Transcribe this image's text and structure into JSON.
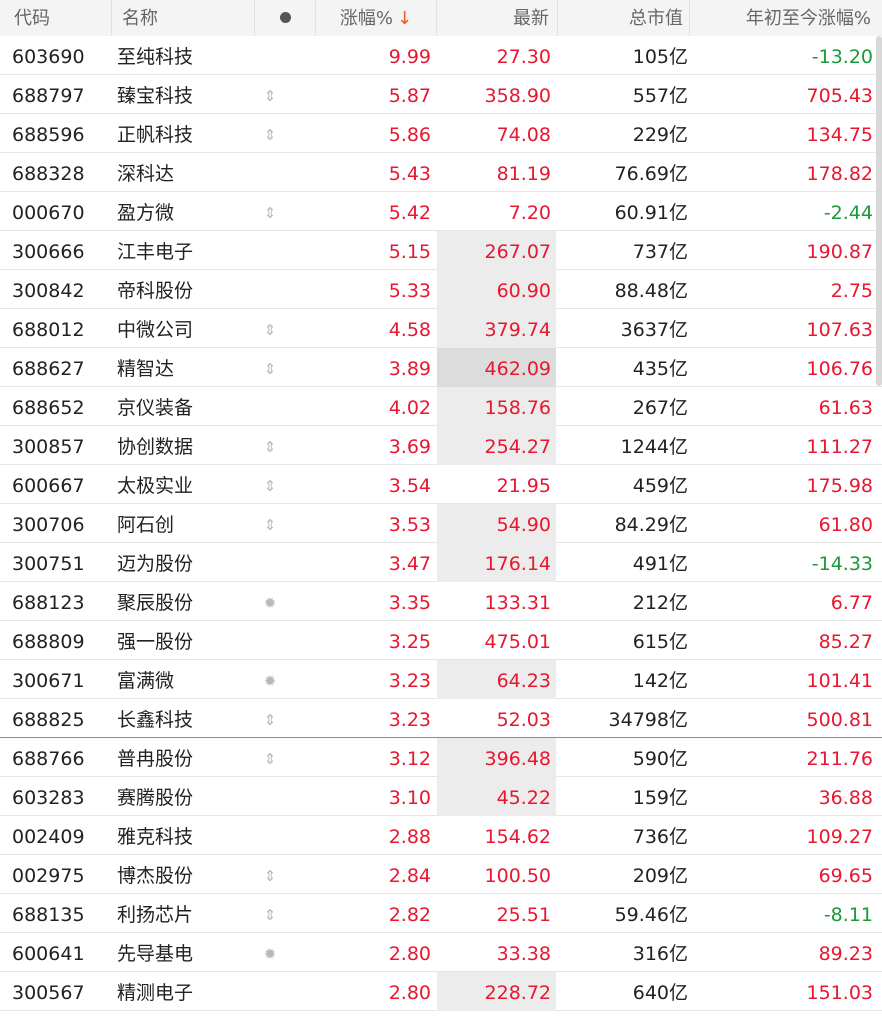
{
  "headers": {
    "code": "代码",
    "name": "名称",
    "change": "涨幅%",
    "sort_arrow": "↓",
    "price": "最新",
    "market_cap": "总市值",
    "ytd": "年初至今涨幅%"
  },
  "colors": {
    "up": "#e8172f",
    "down": "#1a9a3a",
    "sort_arrow": "#ee5a24"
  },
  "rows": [
    {
      "code": "603690",
      "name": "至纯科技",
      "mark": "",
      "change": "9.99",
      "price": "27.30",
      "cap": "105亿",
      "ytd": "-13.20",
      "dir": "down",
      "shade": 0
    },
    {
      "code": "688797",
      "name": "臻宝科技",
      "mark": "⇕",
      "change": "5.87",
      "price": "358.90",
      "cap": "557亿",
      "ytd": "705.43",
      "dir": "up",
      "shade": 0
    },
    {
      "code": "688596",
      "name": "正帆科技",
      "mark": "⇕",
      "change": "5.86",
      "price": "74.08",
      "cap": "229亿",
      "ytd": "134.75",
      "dir": "up",
      "shade": 0
    },
    {
      "code": "688328",
      "name": "深科达",
      "mark": "",
      "change": "5.43",
      "price": "81.19",
      "cap": "76.69亿",
      "ytd": "178.82",
      "dir": "up",
      "shade": 0
    },
    {
      "code": "000670",
      "name": "盈方微",
      "mark": "⇕",
      "change": "5.42",
      "price": "7.20",
      "cap": "60.91亿",
      "ytd": "-2.44",
      "dir": "down",
      "shade": 0
    },
    {
      "code": "300666",
      "name": "江丰电子",
      "mark": "",
      "change": "5.15",
      "price": "267.07",
      "cap": "737亿",
      "ytd": "190.87",
      "dir": "up",
      "shade": 1
    },
    {
      "code": "300842",
      "name": "帝科股份",
      "mark": "",
      "change": "5.33",
      "price": "60.90",
      "cap": "88.48亿",
      "ytd": "2.75",
      "dir": "up",
      "shade": 1
    },
    {
      "code": "688012",
      "name": "中微公司",
      "mark": "⇕",
      "change": "4.58",
      "price": "379.74",
      "cap": "3637亿",
      "ytd": "107.63",
      "dir": "up",
      "shade": 1
    },
    {
      "code": "688627",
      "name": "精智达",
      "mark": "⇕",
      "change": "3.89",
      "price": "462.09",
      "cap": "435亿",
      "ytd": "106.76",
      "dir": "up",
      "shade": 2
    },
    {
      "code": "688652",
      "name": "京仪装备",
      "mark": "",
      "change": "4.02",
      "price": "158.76",
      "cap": "267亿",
      "ytd": "61.63",
      "dir": "up",
      "shade": 1
    },
    {
      "code": "300857",
      "name": "协创数据",
      "mark": "⇕",
      "change": "3.69",
      "price": "254.27",
      "cap": "1244亿",
      "ytd": "111.27",
      "dir": "up",
      "shade": 1
    },
    {
      "code": "600667",
      "name": "太极实业",
      "mark": "⇕",
      "change": "3.54",
      "price": "21.95",
      "cap": "459亿",
      "ytd": "175.98",
      "dir": "up",
      "shade": 0
    },
    {
      "code": "300706",
      "name": "阿石创",
      "mark": "⇕",
      "change": "3.53",
      "price": "54.90",
      "cap": "84.29亿",
      "ytd": "61.80",
      "dir": "up",
      "shade": 1
    },
    {
      "code": "300751",
      "name": "迈为股份",
      "mark": "",
      "change": "3.47",
      "price": "176.14",
      "cap": "491亿",
      "ytd": "-14.33",
      "dir": "down",
      "shade": 1
    },
    {
      "code": "688123",
      "name": "聚辰股份",
      "mark": "✹",
      "change": "3.35",
      "price": "133.31",
      "cap": "212亿",
      "ytd": "6.77",
      "dir": "up",
      "shade": 0
    },
    {
      "code": "688809",
      "name": "强一股份",
      "mark": "",
      "change": "3.25",
      "price": "475.01",
      "cap": "615亿",
      "ytd": "85.27",
      "dir": "up",
      "shade": 0
    },
    {
      "code": "300671",
      "name": "富满微",
      "mark": "✹",
      "change": "3.23",
      "price": "64.23",
      "cap": "142亿",
      "ytd": "101.41",
      "dir": "up",
      "shade": 1
    },
    {
      "code": "688825",
      "name": "长鑫科技",
      "mark": "⇕",
      "change": "3.23",
      "price": "52.03",
      "cap": "34798亿",
      "ytd": "500.81",
      "dir": "up",
      "shade": 0
    },
    {
      "code": "688766",
      "name": "普冉股份",
      "mark": "⇕",
      "change": "3.12",
      "price": "396.48",
      "cap": "590亿",
      "ytd": "211.76",
      "dir": "up",
      "shade": 1
    },
    {
      "code": "603283",
      "name": "赛腾股份",
      "mark": "",
      "change": "3.10",
      "price": "45.22",
      "cap": "159亿",
      "ytd": "36.88",
      "dir": "up",
      "shade": 1
    },
    {
      "code": "002409",
      "name": "雅克科技",
      "mark": "",
      "change": "2.88",
      "price": "154.62",
      "cap": "736亿",
      "ytd": "109.27",
      "dir": "up",
      "shade": 0
    },
    {
      "code": "002975",
      "name": "博杰股份",
      "mark": "⇕",
      "change": "2.84",
      "price": "100.50",
      "cap": "209亿",
      "ytd": "69.65",
      "dir": "up",
      "shade": 0
    },
    {
      "code": "688135",
      "name": "利扬芯片",
      "mark": "⇕",
      "change": "2.82",
      "price": "25.51",
      "cap": "59.46亿",
      "ytd": "-8.11",
      "dir": "down",
      "shade": 0
    },
    {
      "code": "600641",
      "name": "先导基电",
      "mark": "✹",
      "change": "2.80",
      "price": "33.38",
      "cap": "316亿",
      "ytd": "89.23",
      "dir": "up",
      "shade": 0
    },
    {
      "code": "300567",
      "name": "精测电子",
      "mark": "",
      "change": "2.80",
      "price": "228.72",
      "cap": "640亿",
      "ytd": "151.03",
      "dir": "up",
      "shade": 1
    }
  ]
}
